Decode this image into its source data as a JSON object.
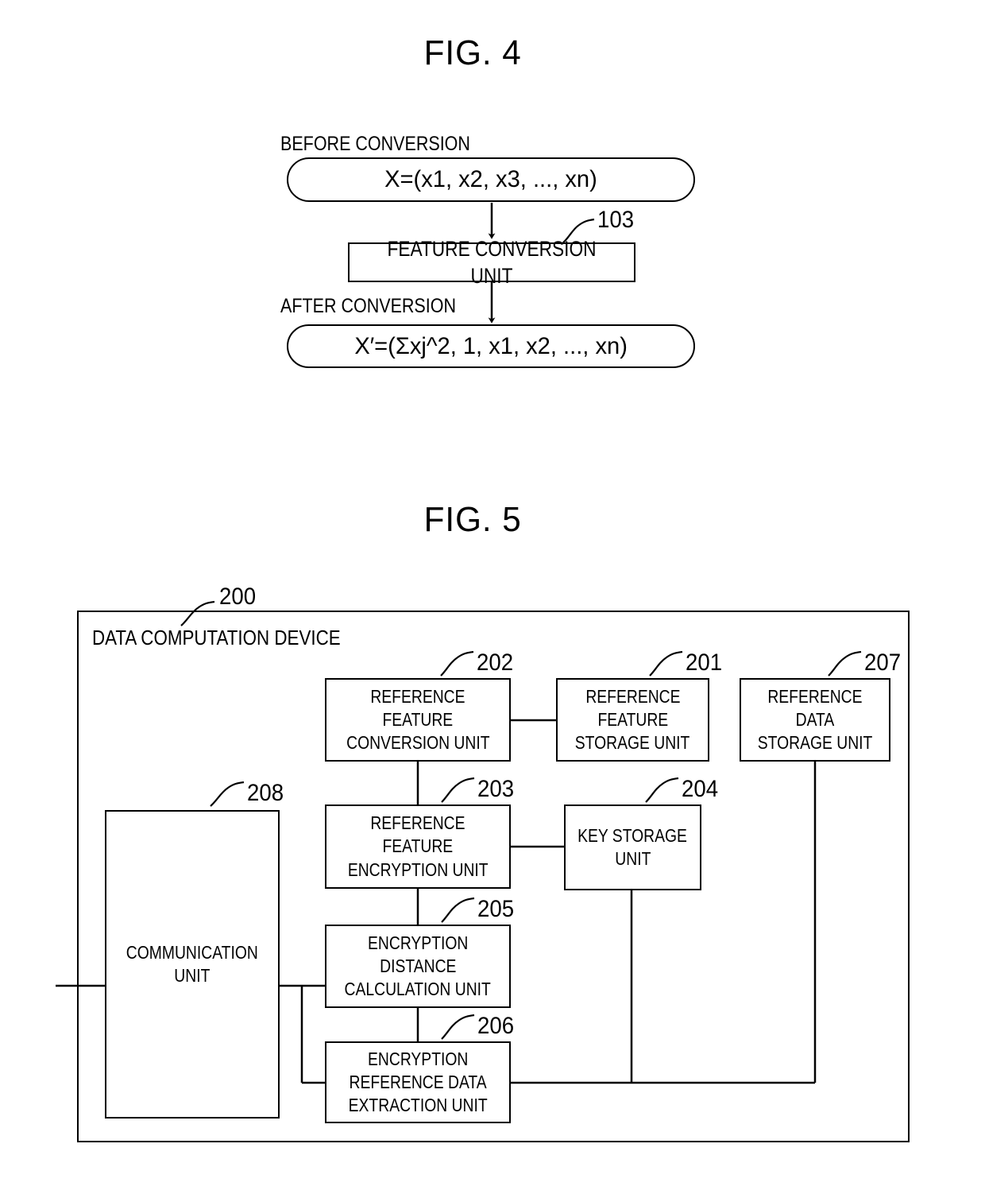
{
  "figures": [
    {
      "id": "fig4",
      "title": "FIG. 4",
      "labels": {
        "before": "BEFORE CONVERSION",
        "after": "AFTER CONVERSION"
      },
      "before_vector": "X=(x1, x2, x3, ..., xn)",
      "after_vector": "X′=(Σxj^2, 1, x1, x2, ..., xn)",
      "unit": {
        "ref": "103",
        "label": "FEATURE CONVERSION UNIT"
      }
    },
    {
      "id": "fig5",
      "title": "FIG. 5",
      "device": {
        "ref": "200",
        "label": "DATA COMPUTATION DEVICE"
      },
      "blocks": [
        {
          "ref": "202",
          "lines": [
            "REFERENCE",
            "FEATURE",
            "CONVERSION UNIT"
          ]
        },
        {
          "ref": "201",
          "lines": [
            "REFERENCE",
            "FEATURE",
            "STORAGE UNIT"
          ]
        },
        {
          "ref": "207",
          "lines": [
            "REFERENCE",
            "DATA",
            "STORAGE UNIT"
          ]
        },
        {
          "ref": "203",
          "lines": [
            "REFERENCE",
            "FEATURE",
            "ENCRYPTION UNIT"
          ]
        },
        {
          "ref": "204",
          "lines": [
            "KEY STORAGE",
            "UNIT"
          ]
        },
        {
          "ref": "205",
          "lines": [
            "ENCRYPTION",
            "DISTANCE",
            "CALCULATION UNIT"
          ]
        },
        {
          "ref": "206",
          "lines": [
            "ENCRYPTION",
            "REFERENCE DATA",
            "EXTRACTION UNIT"
          ]
        },
        {
          "ref": "208",
          "lines": [
            "COMMUNICATION",
            "UNIT"
          ]
        }
      ]
    }
  ],
  "colors": {
    "ink": "#000000",
    "paper": "#ffffff"
  }
}
